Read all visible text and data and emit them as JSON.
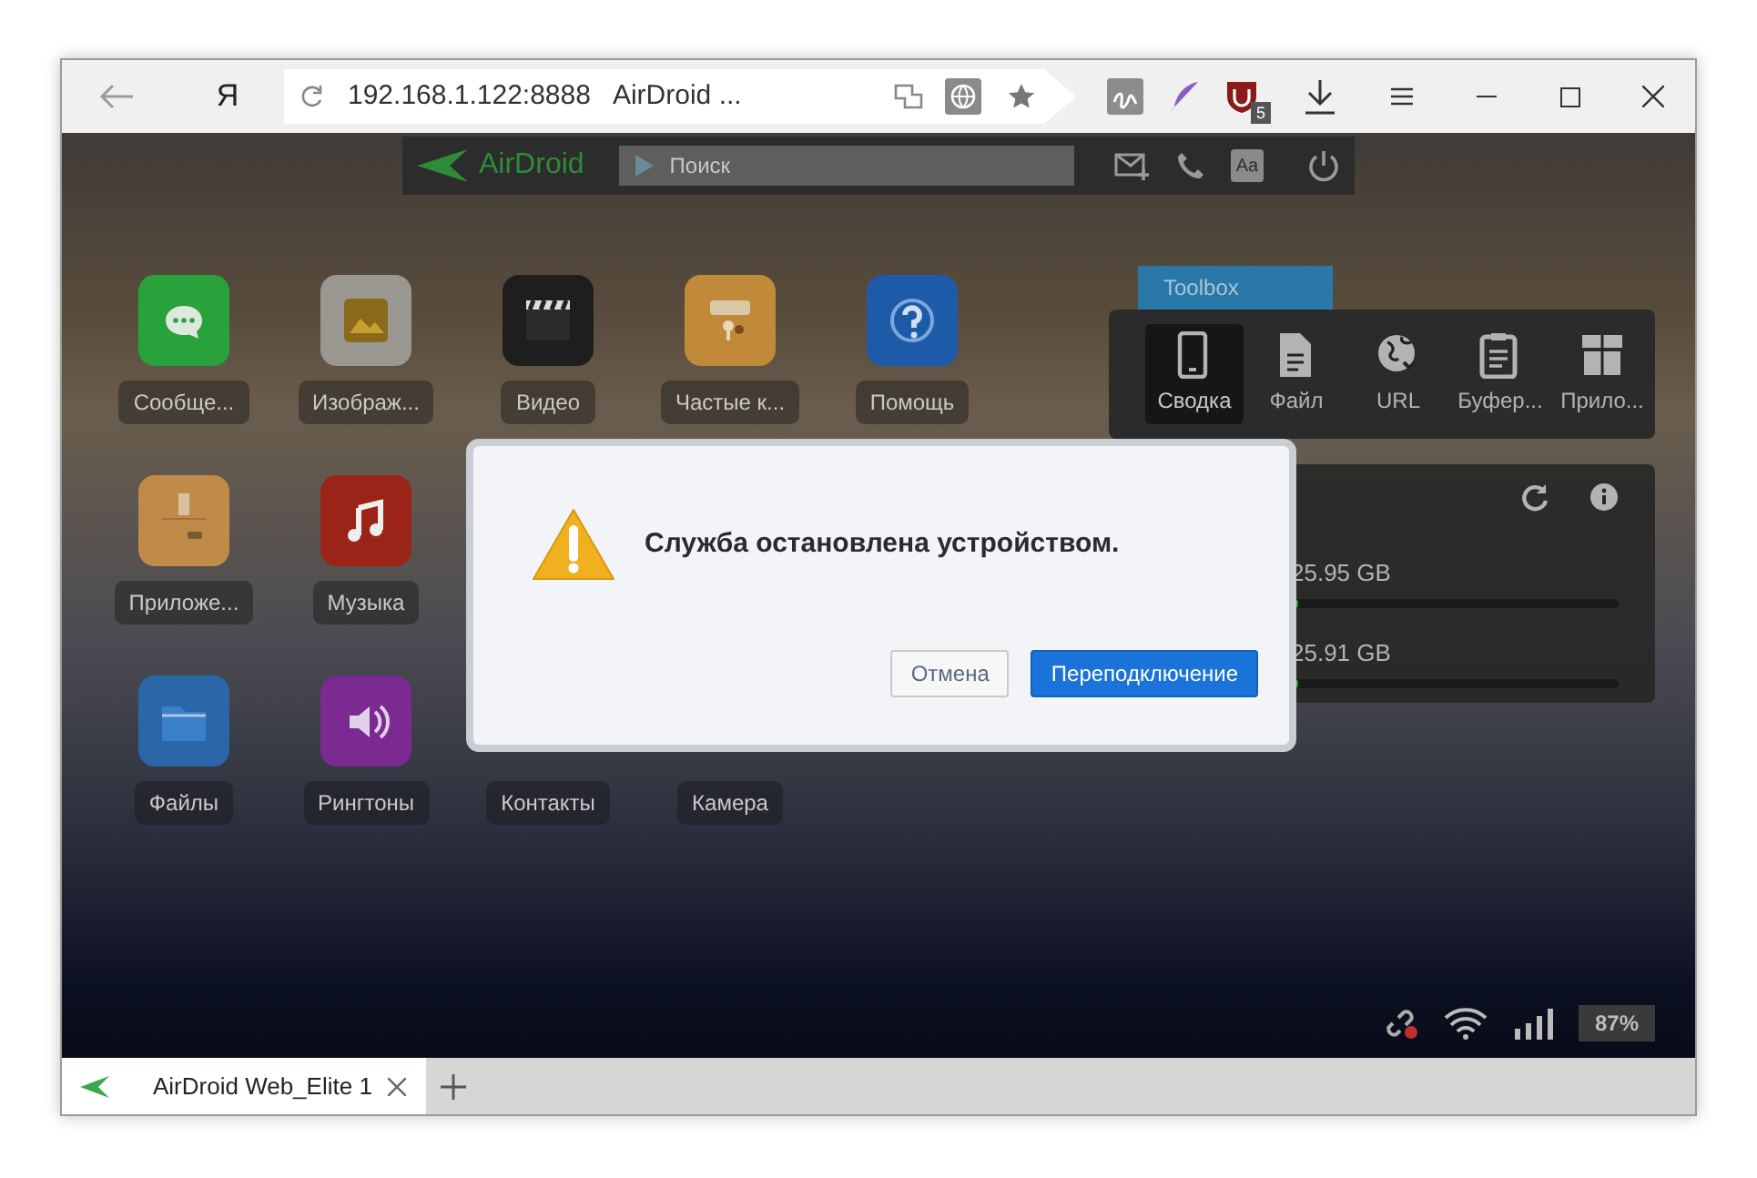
{
  "browser": {
    "logo": "Я",
    "address": "192.168.1.122:8888",
    "page_title": "AirDroid ...",
    "extension_badge": "5"
  },
  "airdroid_bar": {
    "logo": "AirDroid",
    "search": {
      "placeholder": "Поиск"
    },
    "font_button": "Aa"
  },
  "apps": [
    [
      {
        "label": "Сообще...",
        "kind": "messages"
      },
      {
        "label": "Изображ...",
        "kind": "gallery"
      },
      {
        "label": "Видео",
        "kind": "video"
      },
      {
        "label": "Частые к...",
        "kind": "frequent"
      },
      {
        "label": "Помощь",
        "kind": "help"
      }
    ],
    [
      {
        "label": "Приложе...",
        "kind": "apps"
      },
      {
        "label": "Музыка",
        "kind": "music"
      }
    ],
    [
      {
        "label": "Файлы",
        "kind": "files"
      },
      {
        "label": "Рингтоны",
        "kind": "ringtones"
      },
      {
        "label": "Контакты",
        "kind": "hidden"
      },
      {
        "label": "Камера",
        "kind": "hidden"
      }
    ]
  ],
  "toolbox": {
    "title": "Toolbox",
    "items": [
      {
        "label": "Сводка",
        "kind": "phone",
        "selected": true
      },
      {
        "label": "Файл",
        "kind": "file",
        "selected": false
      },
      {
        "label": "URL",
        "kind": "globe",
        "selected": false
      },
      {
        "label": "Буфер...",
        "kind": "clipboard",
        "selected": false
      },
      {
        "label": "Прило...",
        "kind": "box",
        "selected": false
      }
    ]
  },
  "storage": {
    "items": [
      {
        "reading": "25.95 GB",
        "level": 0.02
      },
      {
        "reading": "25.91 GB",
        "level": 0.02
      }
    ]
  },
  "dialog": {
    "message": "Служба остановлена устройством.",
    "buttons": [
      {
        "label": "Отмена",
        "kind": "secondary"
      },
      {
        "label": "Переподключение",
        "kind": "primary"
      }
    ]
  },
  "status": {
    "battery": "87%"
  },
  "tabs": [
    {
      "label": "AirDroid Web_Elite 1",
      "selected": true
    }
  ]
}
